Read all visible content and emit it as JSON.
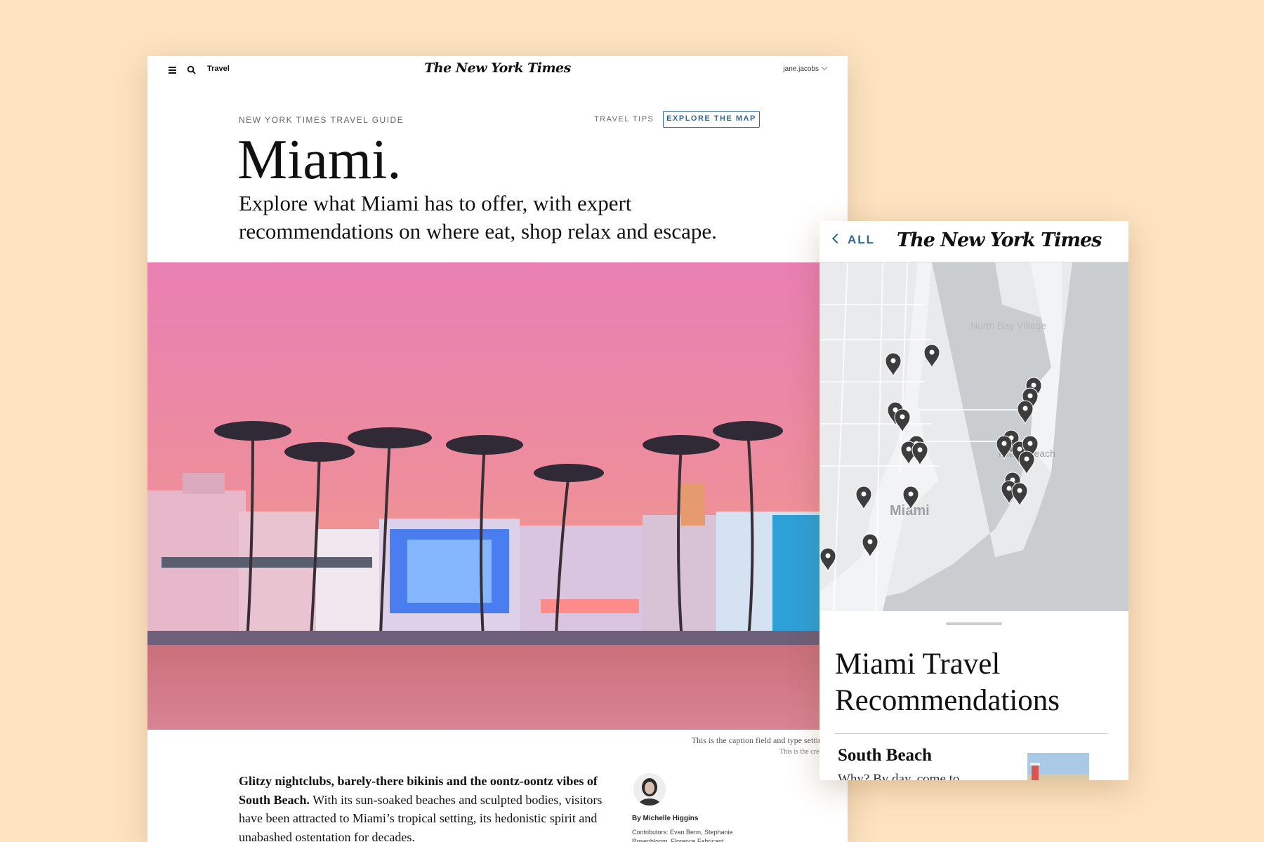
{
  "desktop": {
    "section": "Travel",
    "masthead": "The New York Times",
    "user": "jane.jacobs",
    "kicker": "NEW YORK TIMES TRAVEL GUIDE",
    "travel_tips": "TRAVEL TIPS",
    "explore_button": "EXPLORE THE MAP",
    "title": "Miami.",
    "dek": "Explore what Miami has to offer, with expert recommendations on where eat, shop relax and escape.",
    "caption": "This is the caption field and type setting",
    "credit": "This is the credit",
    "body_lead": "Glitzy nightclubs, barely-there bikinis and the oontz-oontz vibes of South Beach.",
    "body_rest": " With its sun-soaked beaches and sculpted bodies, visitors have been attracted to Miami’s tropical setting, its hedonistic spirit and unabashed ostentation for decades.",
    "byline": "By Michelle Higgins",
    "contributors": "Contributors: Evan Benn, Stephanie Rosenbloom, Florence Fabricant"
  },
  "mobile": {
    "back_label": "ALL",
    "masthead": "The New York Times",
    "map_labels": [
      "North Bay Village",
      "Miami",
      "Miami Beach"
    ],
    "title": "Miami Travel Recommendations",
    "recommendation": {
      "name": "South Beach",
      "snippet": "Why? By day, come to"
    }
  },
  "colors": {
    "background": "#fde3c0",
    "accent": "#326891"
  }
}
